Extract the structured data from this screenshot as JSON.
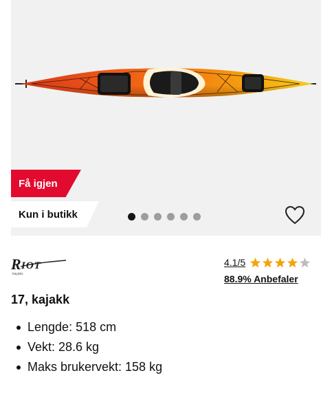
{
  "product": {
    "brand": "Riot",
    "brand_sub": "kayaks",
    "title": "17, kajakk",
    "image_icon": "kayak-product-image"
  },
  "badges": {
    "restock": "Få igjen",
    "store_only": "Kun i butikk"
  },
  "gallery": {
    "total_images": 6,
    "active_index": 0
  },
  "favorite": {
    "icon": "heart-outline-icon"
  },
  "rating": {
    "score_text": "4.1/5",
    "score": 4.1,
    "max": 5,
    "recommend_text": "88.9% Anbefaler",
    "star_color": "#f3a50c",
    "star_empty_color": "#bdbdbd"
  },
  "specs": [
    {
      "text": "Lengde: 518 cm"
    },
    {
      "text": "Vekt: 28.6 kg"
    },
    {
      "text": "Maks brukervekt: 158 kg"
    }
  ],
  "colors": {
    "accent_red": "#e20a2f",
    "image_bg": "#f1f1f1"
  }
}
